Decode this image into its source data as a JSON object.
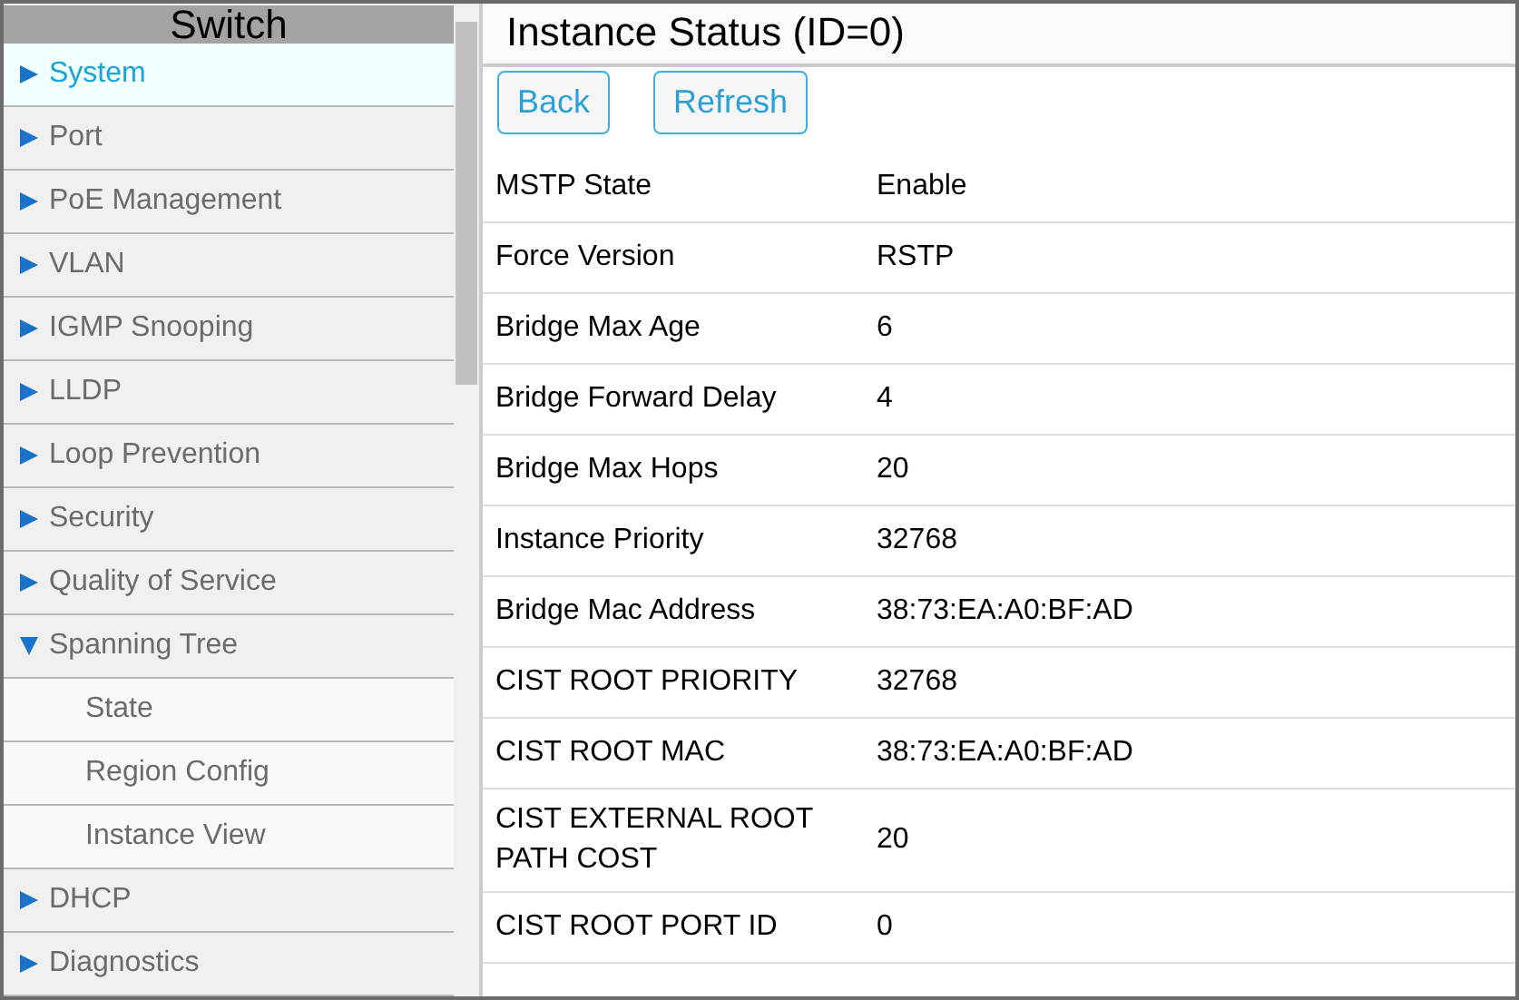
{
  "sidebar": {
    "title": "Switch",
    "items": [
      {
        "label": "System",
        "selected": true,
        "expanded": false
      },
      {
        "label": "Port",
        "selected": false,
        "expanded": false
      },
      {
        "label": "PoE Management",
        "selected": false,
        "expanded": false
      },
      {
        "label": "VLAN",
        "selected": false,
        "expanded": false
      },
      {
        "label": "IGMP Snooping",
        "selected": false,
        "expanded": false
      },
      {
        "label": "LLDP",
        "selected": false,
        "expanded": false
      },
      {
        "label": "Loop Prevention",
        "selected": false,
        "expanded": false
      },
      {
        "label": "Security",
        "selected": false,
        "expanded": false
      },
      {
        "label": "Quality of Service",
        "selected": false,
        "expanded": false
      },
      {
        "label": "Spanning Tree",
        "selected": false,
        "expanded": true,
        "children": [
          {
            "label": "State"
          },
          {
            "label": "Region Config"
          },
          {
            "label": "Instance View"
          }
        ]
      },
      {
        "label": "DHCP",
        "selected": false,
        "expanded": false
      },
      {
        "label": "Diagnostics",
        "selected": false,
        "expanded": false
      }
    ]
  },
  "page": {
    "title": "Instance Status (ID=0)",
    "buttons": [
      "Back",
      "Refresh"
    ],
    "rows": [
      {
        "label": "MSTP State",
        "value": "Enable"
      },
      {
        "label": "Force Version",
        "value": "RSTP"
      },
      {
        "label": "Bridge Max Age",
        "value": "6"
      },
      {
        "label": "Bridge Forward Delay",
        "value": "4"
      },
      {
        "label": "Bridge Max Hops",
        "value": "20"
      },
      {
        "label": "Instance Priority",
        "value": "32768"
      },
      {
        "label": "Bridge Mac Address",
        "value": "38:73:EA:A0:BF:AD"
      },
      {
        "label": "CIST ROOT PRIORITY",
        "value": "32768"
      },
      {
        "label": "CIST ROOT MAC",
        "value": "38:73:EA:A0:BF:AD"
      },
      {
        "label": "CIST EXTERNAL ROOT PATH COST",
        "value": "20"
      },
      {
        "label": "CIST ROOT PORT ID",
        "value": "0"
      }
    ]
  }
}
